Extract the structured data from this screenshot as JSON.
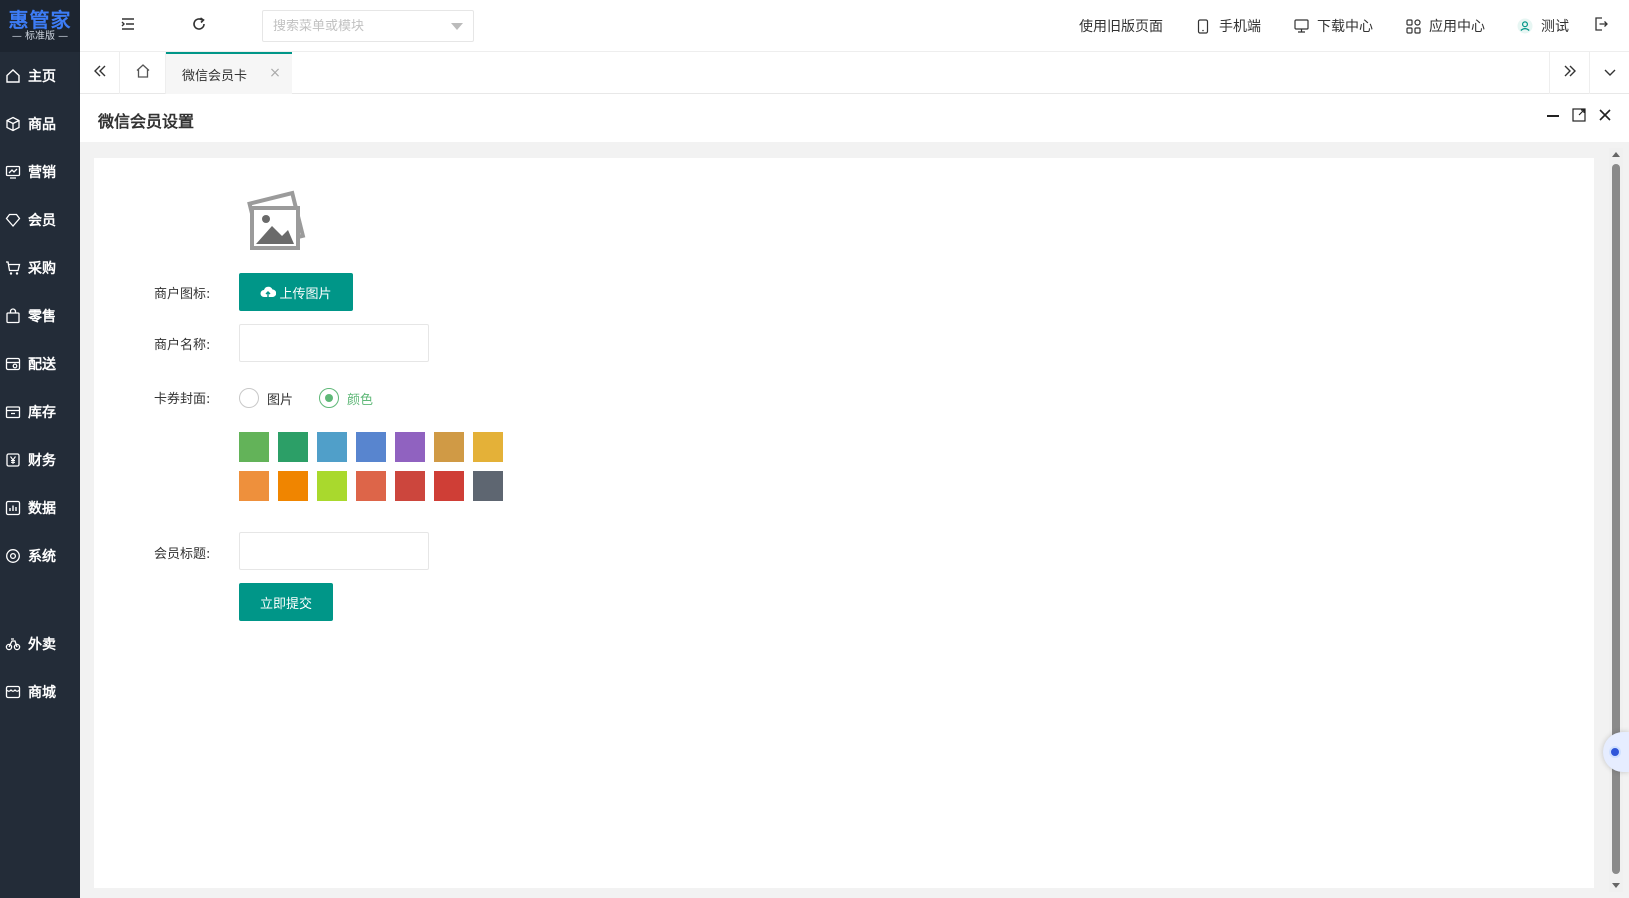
{
  "sidebar": {
    "logo_title": "惠管家",
    "logo_subtitle": "标准版",
    "items": [
      {
        "label": "主页",
        "icon": "home-icon"
      },
      {
        "label": "商品",
        "icon": "cube-icon"
      },
      {
        "label": "营销",
        "icon": "chart-icon"
      },
      {
        "label": "会员",
        "icon": "diamond-icon"
      },
      {
        "label": "采购",
        "icon": "cart-icon"
      },
      {
        "label": "零售",
        "icon": "bag-icon"
      },
      {
        "label": "配送",
        "icon": "delivery-icon"
      },
      {
        "label": "库存",
        "icon": "box-icon"
      },
      {
        "label": "财务",
        "icon": "yuan-icon"
      },
      {
        "label": "数据",
        "icon": "bar-chart-icon"
      },
      {
        "label": "系统",
        "icon": "settings-icon"
      },
      {
        "label": "外卖",
        "icon": "bike-icon"
      },
      {
        "label": "商城",
        "icon": "store-icon"
      }
    ]
  },
  "topbar": {
    "search_placeholder": "搜索菜单或模块",
    "old_version": "使用旧版页面",
    "mobile": "手机端",
    "download_center": "下载中心",
    "app_center": "应用中心",
    "user": "测试"
  },
  "tabs": {
    "active_label": "微信会员卡",
    "close_glyph": "×"
  },
  "page": {
    "title": "微信会员设置"
  },
  "form": {
    "merchant_icon_label": "商户图标:",
    "upload_label": "上传图片",
    "merchant_name_label": "商户名称:",
    "merchant_name_value": "",
    "card_cover_label": "卡券封面:",
    "cover_option_image": "图片",
    "cover_option_color": "颜色",
    "cover_selected": "颜色",
    "colors": [
      "#63b359",
      "#2c9f67",
      "#509fc9",
      "#5885cf",
      "#9062c0",
      "#d09a45",
      "#e4b138",
      "#ee903c",
      "#f08500",
      "#a9d92d",
      "#dd6549",
      "#cc463d",
      "#cf3e36",
      "#5e6671"
    ],
    "member_title_label": "会员标题:",
    "member_title_value": "",
    "submit_label": "立即提交"
  },
  "theme": {
    "primary": "#009688",
    "sidebar_bg": "#232c38",
    "radio_checked": "#5fb878"
  }
}
